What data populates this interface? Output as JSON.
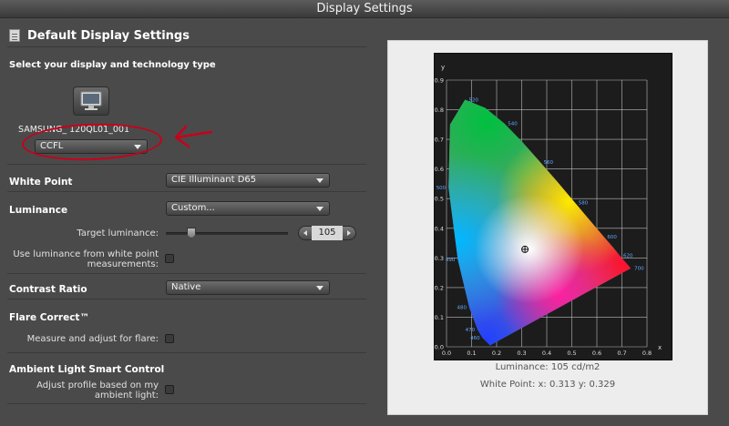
{
  "window": {
    "title": "Display Settings"
  },
  "panel": {
    "title": "Default Display Settings",
    "icon": "document-icon"
  },
  "display_type": {
    "heading": "Select your display and technology type",
    "monitor_name": "SAMSUNG_    120QL01_001",
    "technology": "CCFL"
  },
  "white_point": {
    "label": "White Point",
    "value": "CIE Illuminant D65"
  },
  "luminance": {
    "label": "Luminance",
    "mode": "Custom...",
    "target_label": "Target luminance:",
    "target_value": "105",
    "from_wp_label": "Use luminance from white point measurements:"
  },
  "contrast": {
    "label": "Contrast Ratio",
    "value": "Native"
  },
  "flare": {
    "label": "Flare Correct™",
    "measure_label": "Measure and adjust for flare:"
  },
  "ambient": {
    "label": "Ambient Light Smart Control",
    "adjust_label": "Adjust profile based on my ambient light:"
  },
  "chart_data": {
    "type": "scatter",
    "xlabel": "x",
    "ylabel": "y",
    "xlim": [
      0,
      0.8
    ],
    "ylim": [
      0,
      0.9
    ],
    "x_ticks": [
      "0.0",
      "0.1",
      "0.2",
      "0.3",
      "0.4",
      "0.5",
      "0.6",
      "0.7",
      "0.8"
    ],
    "y_ticks": [
      "0.0",
      "0.1",
      "0.2",
      "0.3",
      "0.4",
      "0.5",
      "0.6",
      "0.7",
      "0.8",
      "0.9"
    ],
    "locus_labels": [
      {
        "text": "520",
        "x": 0.074,
        "y": 0.834
      },
      {
        "text": "540",
        "x": 0.23,
        "y": 0.754
      },
      {
        "text": "560",
        "x": 0.373,
        "y": 0.624
      },
      {
        "text": "580",
        "x": 0.512,
        "y": 0.487
      },
      {
        "text": "600",
        "x": 0.627,
        "y": 0.372
      },
      {
        "text": "620",
        "x": 0.691,
        "y": 0.308
      },
      {
        "text": "700",
        "x": 0.735,
        "y": 0.265
      },
      {
        "text": "500",
        "x": 0.008,
        "y": 0.538
      },
      {
        "text": "490",
        "x": 0.045,
        "y": 0.295
      },
      {
        "text": "480",
        "x": 0.091,
        "y": 0.133
      },
      {
        "text": "470",
        "x": 0.124,
        "y": 0.058
      },
      {
        "text": "460",
        "x": 0.144,
        "y": 0.03
      }
    ],
    "points": [
      {
        "name": "White Point",
        "x": 0.313,
        "y": 0.329
      }
    ],
    "luminance_caption": "Luminance:  105 cd/m2",
    "white_point_caption": "White Point: x: 0.313  y: 0.329"
  }
}
